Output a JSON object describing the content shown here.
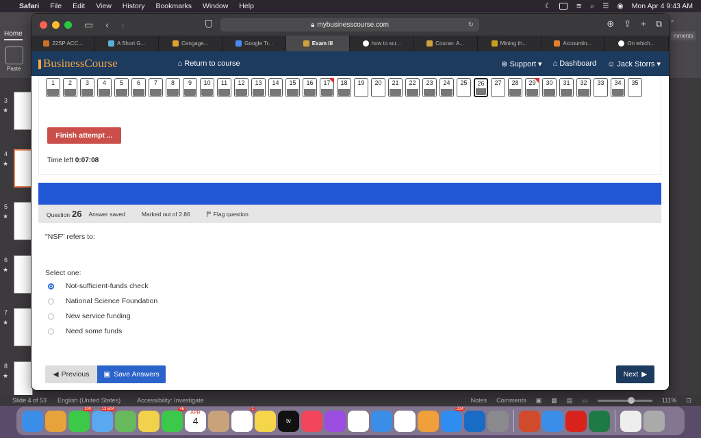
{
  "menubar": {
    "app": "Safari",
    "items": [
      "File",
      "Edit",
      "View",
      "History",
      "Bookmarks",
      "Window",
      "Help"
    ],
    "clock": "Mon Apr 4  9:43 AM"
  },
  "ppt": {
    "tab_home": "Home",
    "paste_label": "Paste",
    "comments": "mments",
    "slides": [
      {
        "num": "3",
        "star": "★"
      },
      {
        "num": "4",
        "star": "★"
      },
      {
        "num": "5",
        "star": "★"
      },
      {
        "num": "6",
        "star": "★"
      },
      {
        "num": "7",
        "star": "★"
      },
      {
        "num": "8",
        "star": "★"
      }
    ],
    "status": {
      "slide": "Slide 4 of 53",
      "lang": "English (United States)",
      "access": "Accessibility: Investigate",
      "notes": "Notes",
      "comments": "Comments",
      "zoom": "111%"
    }
  },
  "safari": {
    "url": "mybusinesscourse.com",
    "tabs": [
      {
        "label": "22SP ACC...",
        "color": "#c8702c"
      },
      {
        "label": "A Short G...",
        "color": "#5ab0d8"
      },
      {
        "label": "Cengage...",
        "color": "#e0a030"
      },
      {
        "label": "Google Tr...",
        "color": "#4a8af4"
      },
      {
        "label": "Exam III",
        "color": "#d0a040",
        "active": true
      },
      {
        "label": "how to scr...",
        "color": "#ffffff"
      },
      {
        "label": "Course: A...",
        "color": "#d0a040"
      },
      {
        "label": "Mining th...",
        "color": "#c8a020"
      },
      {
        "label": "Accountin...",
        "color": "#e08030"
      },
      {
        "label": "On which...",
        "color": "#ffffff"
      }
    ]
  },
  "site": {
    "brand": "BusinessCourse",
    "return": "Return to course",
    "support": "Support",
    "dashboard": "Dashboard",
    "user": "Jack Storrs"
  },
  "quiz": {
    "questions": [
      {
        "n": "1",
        "s": "ans"
      },
      {
        "n": "2",
        "s": "ans"
      },
      {
        "n": "3",
        "s": "ans"
      },
      {
        "n": "4",
        "s": "ans"
      },
      {
        "n": "5",
        "s": "ans"
      },
      {
        "n": "6",
        "s": "ans"
      },
      {
        "n": "7",
        "s": "ans"
      },
      {
        "n": "8",
        "s": "ans"
      },
      {
        "n": "9",
        "s": "ans"
      },
      {
        "n": "10",
        "s": "ans"
      },
      {
        "n": "11",
        "s": "ans"
      },
      {
        "n": "12",
        "s": "ans"
      },
      {
        "n": "13",
        "s": "ans"
      },
      {
        "n": "14",
        "s": "ans"
      },
      {
        "n": "15",
        "s": "ans"
      },
      {
        "n": "16",
        "s": "ans"
      },
      {
        "n": "17",
        "s": "ans",
        "flag": true
      },
      {
        "n": "18",
        "s": "ans"
      },
      {
        "n": "19",
        "s": "unans"
      },
      {
        "n": "20",
        "s": "unans"
      },
      {
        "n": "21",
        "s": "ans"
      },
      {
        "n": "22",
        "s": "ans"
      },
      {
        "n": "23",
        "s": "ans"
      },
      {
        "n": "24",
        "s": "ans"
      },
      {
        "n": "25",
        "s": "unans"
      },
      {
        "n": "26",
        "s": "ans",
        "current": true
      },
      {
        "n": "27",
        "s": "unans"
      },
      {
        "n": "28",
        "s": "ans"
      },
      {
        "n": "29",
        "s": "ans",
        "flag": true
      },
      {
        "n": "30",
        "s": "ans"
      },
      {
        "n": "31",
        "s": "ans"
      },
      {
        "n": "32",
        "s": "ans"
      },
      {
        "n": "33",
        "s": "unans"
      },
      {
        "n": "34",
        "s": "ans"
      },
      {
        "n": "35",
        "s": "unans"
      }
    ],
    "finish": "Finish attempt ...",
    "time_label": "Time left",
    "time_value": "0:07:08",
    "question_label": "Question",
    "question_no": "26",
    "state": "Answer saved",
    "marked": "Marked out of 2.86",
    "flag": "Flag question",
    "text": "\"NSF\" refers to:",
    "select": "Select one:",
    "options": [
      {
        "label": "Not-sufficient-funds check",
        "checked": true
      },
      {
        "label": "National Science Foundation",
        "checked": false
      },
      {
        "label": "New service funding",
        "checked": false
      },
      {
        "label": "Need some funds",
        "checked": false
      }
    ],
    "prev": "Previous",
    "save": "Save Answers",
    "next": "Next"
  },
  "dock": {
    "badges": {
      "messages": "100",
      "mail": "13,604",
      "facetime": "46",
      "calendar_day": "4",
      "calendar_month": "APR",
      "reminders": "1",
      "appstore": "224"
    }
  }
}
